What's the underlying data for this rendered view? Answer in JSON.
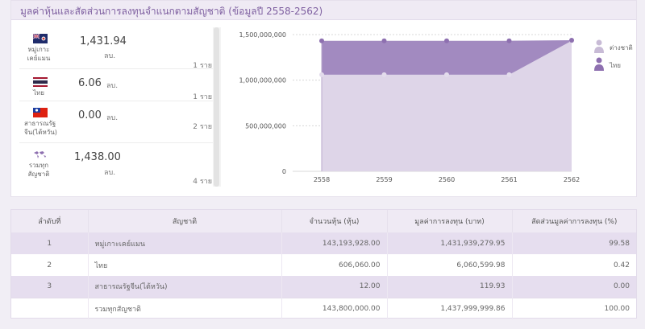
{
  "panel": {
    "title": "มูลค่าหุ้นและสัดส่วนการลงทุนจำแนกตามสัญชาติ (ข้อมูลปี 2558-2562)"
  },
  "cards": [
    {
      "name": "หมู่เกาะเคย์แมน",
      "value": "1,431.94",
      "unit": "ลบ.",
      "count": "1 ราย",
      "icon": "cayman-flag-icon"
    },
    {
      "name": "ไทย",
      "value": "6.06",
      "unit": "ลบ.",
      "count": "1 ราย",
      "icon": "thailand-flag-icon"
    },
    {
      "name": "สาธารณรัฐจีน(ไต้หวัน)",
      "value": "0.00",
      "unit": "ลบ.",
      "count": "2 ราย",
      "icon": "taiwan-flag-icon"
    },
    {
      "name": "รวมทุกสัญชาติ",
      "value": "1,438.00",
      "unit": "ลบ.",
      "count": "4 ราย",
      "icon": "world-map-icon"
    }
  ],
  "legend": [
    {
      "label": "ต่างชาติ",
      "color": "#c8bbd6",
      "icon": "person-icon"
    },
    {
      "label": "ไทย",
      "color": "#8e70b0",
      "icon": "person-icon"
    }
  ],
  "chart_data": {
    "type": "area",
    "x": [
      "2558",
      "2559",
      "2560",
      "2561",
      "2562"
    ],
    "series": [
      {
        "name": "ต่างชาติ",
        "values": [
          1060000000,
          1060000000,
          1060000000,
          1060000000,
          1431939279.95
        ],
        "color": "#ded5e8"
      },
      {
        "name": "ไทย",
        "values": [
          1431939279.95,
          1431939279.95,
          1431939279.95,
          1431939279.95,
          1437999999.86
        ],
        "color": "#a28ac0"
      }
    ],
    "yticks": [
      0,
      500000000,
      1000000000,
      1500000000
    ],
    "ytick_labels": [
      "0",
      "500,000,000",
      "1,000,000,000",
      "1,500,000,000"
    ],
    "ylim": [
      0,
      1500000000
    ],
    "grid": true
  },
  "table": {
    "headers": [
      "ลำดับที่",
      "สัญชาติ",
      "จำนวนหุ้น (หุ้น)",
      "มูลค่าการลงทุน (บาท)",
      "สัดส่วนมูลค่าการลงทุน (%)"
    ],
    "rows": [
      [
        "1",
        "หมู่เกาะเคย์แมน",
        "143,193,928.00",
        "1,431,939,279.95",
        "99.58"
      ],
      [
        "2",
        "ไทย",
        "606,060.00",
        "6,060,599.98",
        "0.42"
      ],
      [
        "3",
        "สาธารณรัฐจีน(ไต้หวัน)",
        "12.00",
        "119.93",
        "0.00"
      ],
      [
        "",
        "รวมทุกสัญชาติ",
        "143,800,000.00",
        "1,437,999,999.86",
        "100.00"
      ]
    ]
  }
}
